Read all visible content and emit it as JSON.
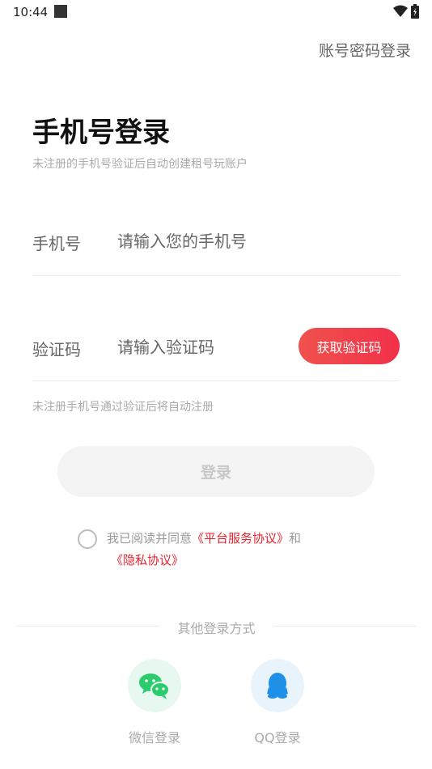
{
  "status_bar": {
    "time": "10:44"
  },
  "header": {
    "account_password_login": "账号密码登录"
  },
  "title": "手机号登录",
  "subtitle": "未注册的手机号验证后自动创建租号玩账户",
  "phone_field": {
    "label": "手机号",
    "placeholder": "请输入您的手机号"
  },
  "code_field": {
    "label": "验证码",
    "placeholder": "请输入验证码",
    "button_label": "获取验证码"
  },
  "hint": "未注册手机号通过验证后将自动注册",
  "login_button": "登录",
  "agreement": {
    "prefix": "我已阅读并同意",
    "platform_agreement": "《平台服务协议》",
    "conjunction": "和",
    "privacy_agreement": "《隐私协议》"
  },
  "other_login": {
    "title": "其他登录方式",
    "wechat_label": "微信登录",
    "qq_label": "QQ登录"
  },
  "colors": {
    "accent": "#F23049",
    "wechat": "#2BCB6E",
    "qq": "#1E90E8"
  }
}
